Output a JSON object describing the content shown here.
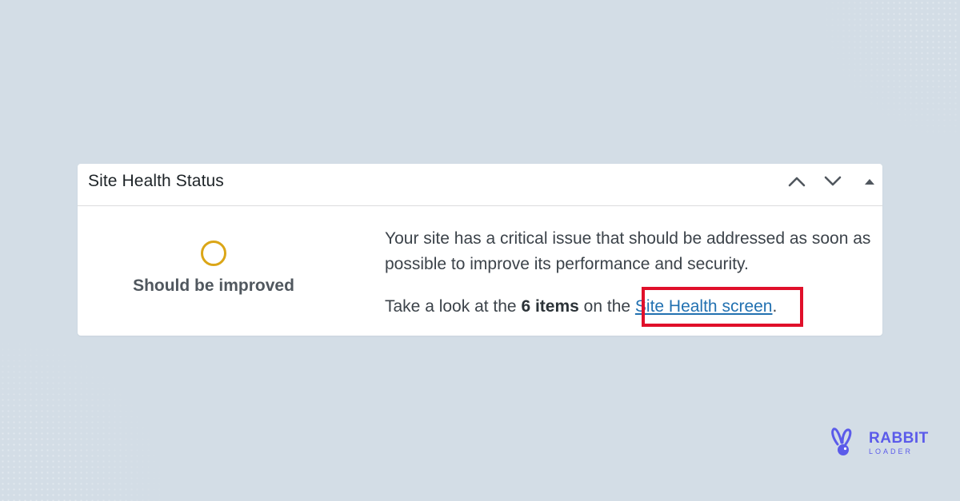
{
  "widget": {
    "title": "Site Health Status",
    "controls": {
      "move_up_icon": "chevron-up-icon",
      "move_down_icon": "chevron-down-icon",
      "toggle_icon": "triangle-up-icon"
    },
    "status": {
      "label": "Should be improved",
      "ring_color": "#dba617"
    },
    "description": "Your site has a critical issue that should be addressed as soon as possible to improve its performance and security.",
    "items_line": {
      "prefix": "Take a look at the ",
      "count_text": "6 items",
      "middle": " on the ",
      "link_text": "Site Health screen",
      "suffix": "."
    }
  },
  "annotation": {
    "highlight_color": "#e0102a"
  },
  "brand": {
    "name": "RABBIT",
    "sub": "LOADER",
    "color": "#5b5bea"
  },
  "colors": {
    "background": "#d3dde6",
    "link": "#2271b1"
  }
}
